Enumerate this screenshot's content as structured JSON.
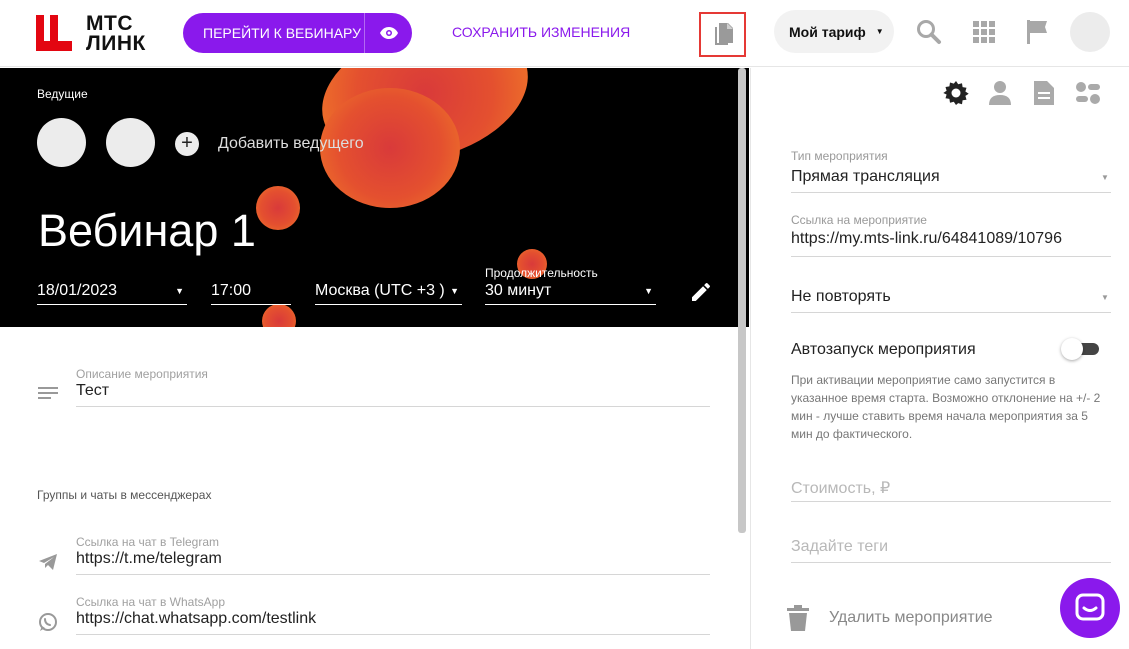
{
  "header": {
    "logo_line1": "МТС",
    "logo_line2": "ЛИНК",
    "webinar_button": "ПЕРЕЙТИ К ВЕБИНАРУ",
    "save_link": "СОХРАНИТЬ ИЗМЕНЕНИЯ",
    "tariff": "Мой тариф"
  },
  "hero": {
    "hosts_label": "Ведущие",
    "add_host": "Добавить ведущего",
    "title": "Вебинар 1",
    "date": "18/01/2023",
    "time": "17:00",
    "timezone": "Москва (UTC +3 )",
    "duration_label": "Продолжительность",
    "duration": "30 минут"
  },
  "left": {
    "description_label": "Описание мероприятия",
    "description_value": "Тест",
    "messengers_section": "Группы и чаты в мессенджерах",
    "telegram_label": "Ссылка на чат в Telegram",
    "telegram_value": "https://t.me/telegram",
    "whatsapp_label": "Ссылка на чат в WhatsApp",
    "whatsapp_value": "https://chat.whatsapp.com/testlink"
  },
  "right": {
    "event_type_label": "Тип мероприятия",
    "event_type_value": "Прямая трансляция",
    "event_link_label": "Ссылка на мероприятие",
    "event_link_value": "https://my.mts-link.ru/64841089/10796",
    "repeat_value": "Не повторять",
    "autostart_label": "Автозапуск мероприятия",
    "autostart_hint": "При активации мероприятие само запустится в указанное время старта. Возможно отклонение на +/- 2 мин - лучше ставить время начала мероприятия за 5 мин до фактического.",
    "price_placeholder": "Стоимость, ₽",
    "tags_placeholder": "Задайте теги",
    "delete_label": "Удалить мероприятие"
  },
  "colors": {
    "accent": "#8a19ec",
    "brand_red": "#e30611",
    "highlight_border": "#e53935"
  },
  "icons": [
    "eye-icon",
    "copy-icon",
    "search-icon",
    "apps-grid-icon",
    "flag-icon",
    "plus-icon",
    "edit-pencil-icon",
    "lines-icon",
    "telegram-icon",
    "whatsapp-icon",
    "gear-icon",
    "person-icon",
    "document-icon",
    "settings-list-icon",
    "trash-icon",
    "chat-icon"
  ]
}
